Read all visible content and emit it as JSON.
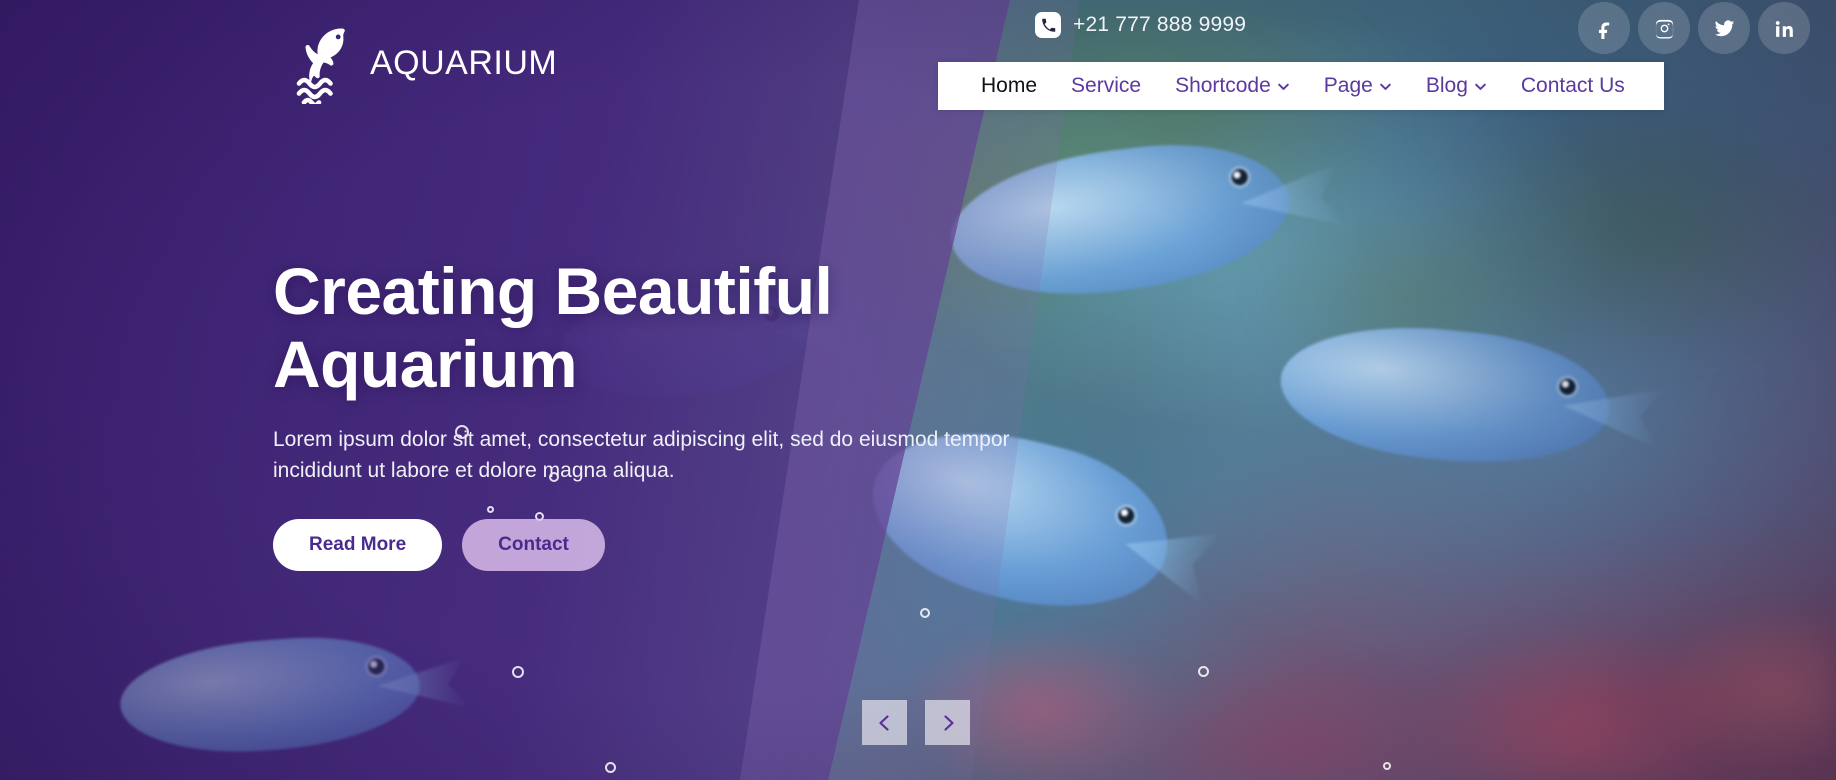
{
  "site": {
    "brand_name": "AQUARIUM",
    "logo_icon": "dolphin-waves-icon"
  },
  "topbar": {
    "phone_icon": "phone-icon",
    "phone": "+21 777 888 9999",
    "socials": [
      {
        "name": "facebook",
        "icon": "facebook-icon"
      },
      {
        "name": "instagram",
        "icon": "instagram-icon"
      },
      {
        "name": "twitter",
        "icon": "twitter-icon"
      },
      {
        "name": "linkedin",
        "icon": "linkedin-icon"
      }
    ]
  },
  "nav": {
    "items": [
      {
        "label": "Home",
        "active": true,
        "has_dropdown": false
      },
      {
        "label": "Service",
        "active": false,
        "has_dropdown": false
      },
      {
        "label": "Shortcode",
        "active": false,
        "has_dropdown": true
      },
      {
        "label": "Page",
        "active": false,
        "has_dropdown": true
      },
      {
        "label": "Blog",
        "active": false,
        "has_dropdown": true
      },
      {
        "label": "Contact Us",
        "active": false,
        "has_dropdown": false
      }
    ]
  },
  "hero": {
    "title_line1": "Creating Beautiful",
    "title_line2": "Aquarium",
    "subtitle": "Lorem ipsum dolor sit amet, consectetur adipiscing elit, sed do eiusmod tempor incididunt ut labore et dolore magna aliqua.",
    "primary_button": "Read More",
    "secondary_button": "Contact"
  },
  "slider": {
    "prev_icon": "chevron-left-icon",
    "next_icon": "chevron-right-icon"
  },
  "colors": {
    "nav_link": "#5b3aa0",
    "nav_active": "#101018",
    "navbar_bg": "#ffffff",
    "primary_button_bg": "#ffffff",
    "primary_button_text": "#4b2a90",
    "secondary_button_bg": "#e2c4f0",
    "overlay_purple": "#3b1a6e"
  }
}
